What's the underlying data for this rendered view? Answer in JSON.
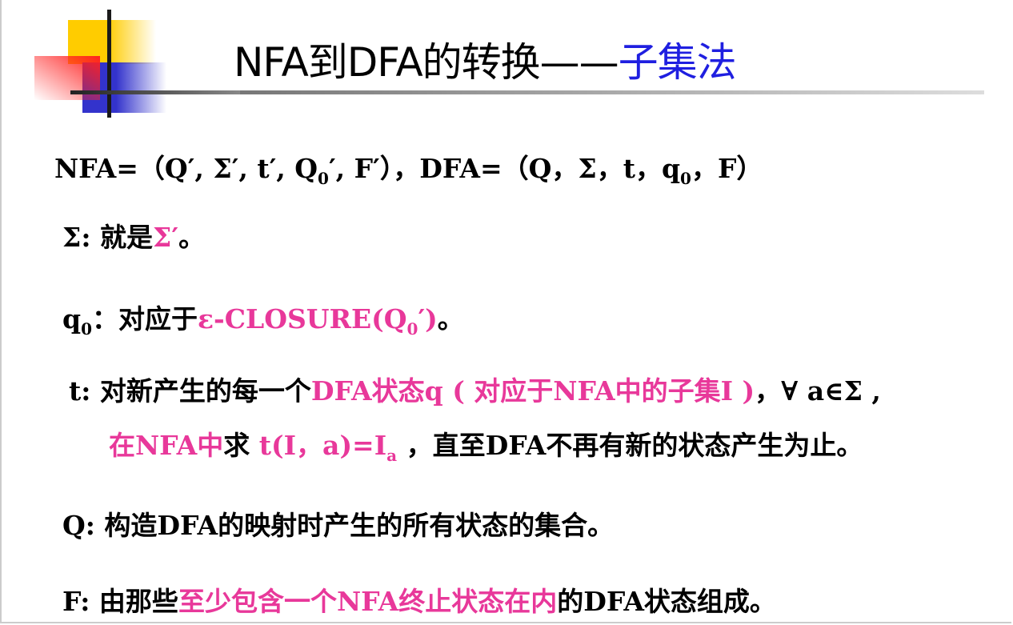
{
  "title": {
    "black": "NFA到DFA的转换——",
    "blue": "子集法"
  },
  "colors": {
    "pink": "#e8389a",
    "blue": "#1f1fe0"
  },
  "lines": [
    [
      {
        "t": "NFA=（Q′, Σ′, t′, Q"
      },
      {
        "t": "0",
        "sub": true
      },
      {
        "t": "′, F′），DFA=（Q，Σ，t，q"
      },
      {
        "t": "0",
        "sub": true
      },
      {
        "t": "，F）"
      }
    ],
    [
      {
        "t": "Σ:  就是"
      },
      {
        "t": "Σ′",
        "pink": true
      },
      {
        "t": "。"
      }
    ],
    [
      {
        "t": "q"
      },
      {
        "t": "0",
        "sub": true
      },
      {
        "t": "：对应于"
      },
      {
        "t": "ε-CLOSURE(Q",
        "pink": true
      },
      {
        "t": "0",
        "sub": true,
        "pink": true
      },
      {
        "t": "′)",
        "pink": true
      },
      {
        "t": "。"
      }
    ],
    [
      {
        "t": "t: 对新产生的每一个"
      },
      {
        "t": "DFA状态q ( 对应于NFA中的子集I )",
        "pink": true
      },
      {
        "t": "，∀ a∈Σ ,"
      }
    ],
    [
      {
        "t": "在NFA中",
        "pink": true
      },
      {
        "t": "求 "
      },
      {
        "t": "t(I，a)=I",
        "pink": true
      },
      {
        "t": "a",
        "sub": true,
        "pink": true
      },
      {
        "t": " ，直至DFA不再有新的状态产生为止。"
      }
    ],
    [
      {
        "t": "Q: 构造DFA的映射时产生的所有状态的集合。"
      }
    ],
    [
      {
        "t": "F: 由那些"
      },
      {
        "t": "至少包含一个NFA终止状态在内",
        "pink": true
      },
      {
        "t": "的DFA状态组成。"
      }
    ]
  ]
}
